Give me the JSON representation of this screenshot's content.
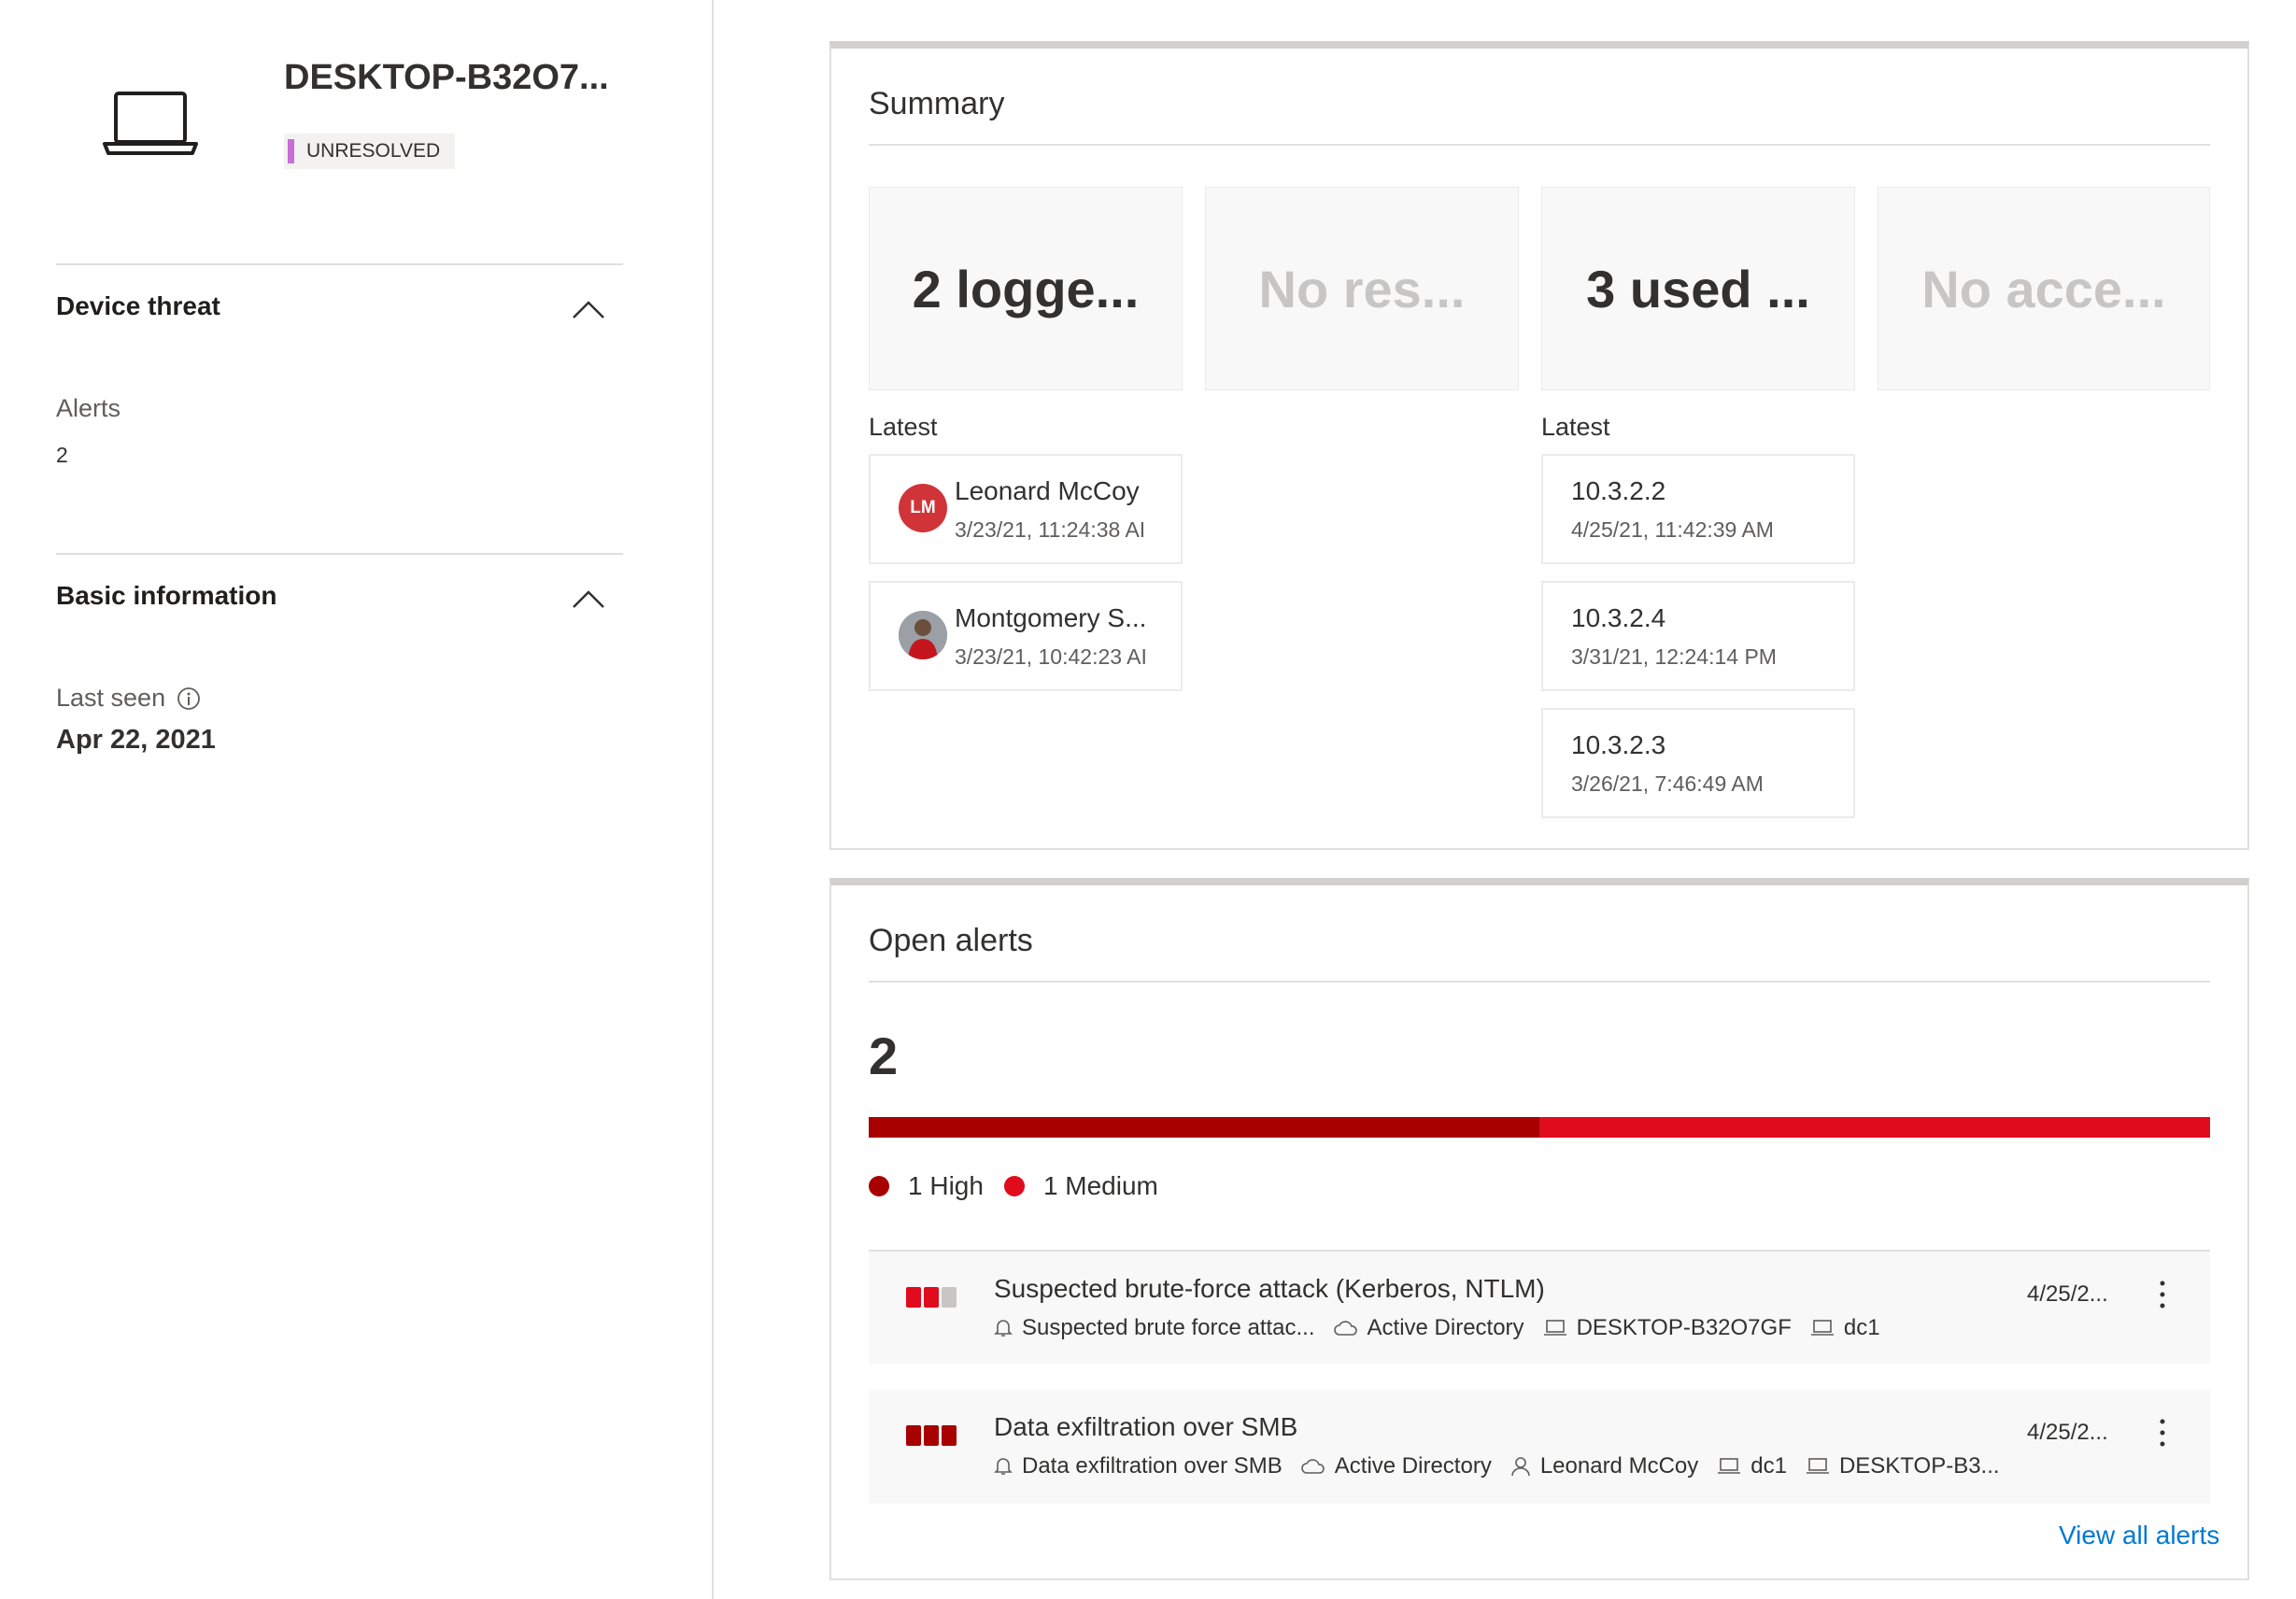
{
  "device": {
    "name": "DESKTOP-B32O7...",
    "status": "UNRESOLVED",
    "icon": "laptop-icon"
  },
  "device_threat": {
    "title": "Device threat",
    "alerts_label": "Alerts",
    "alerts_value": "2"
  },
  "basic_info": {
    "title": "Basic information",
    "last_seen_label": "Last seen",
    "last_seen_value": "Apr 22, 2021"
  },
  "summary": {
    "title": "Summary",
    "tiles": [
      {
        "text": "2 logge...",
        "style": "dark"
      },
      {
        "text": "No res...",
        "style": "muted"
      },
      {
        "text": "3 used ...",
        "style": "dark"
      },
      {
        "text": "No acce...",
        "style": "muted"
      }
    ],
    "latest_label": "Latest",
    "users": [
      {
        "name": "Leonard McCoy",
        "time": "3/23/21, 11:24:38 AI",
        "initials": "LM"
      },
      {
        "name": "Montgomery S...",
        "time": "3/23/21, 10:42:23 AI"
      }
    ],
    "ips": [
      {
        "ip": "10.3.2.2",
        "time": "4/25/21, 11:42:39 AM"
      },
      {
        "ip": "10.3.2.4",
        "time": "3/31/21, 12:24:14 PM"
      },
      {
        "ip": "10.3.2.3",
        "time": "3/26/21, 7:46:49 AM"
      }
    ]
  },
  "open_alerts": {
    "title": "Open alerts",
    "count": "2",
    "high_fraction": 0.5,
    "legend": {
      "high": "1 High",
      "medium": "1 Medium"
    },
    "colors": {
      "high": "#a80000",
      "medium": "#e00b1c",
      "inactive": "#c8c6c4"
    },
    "alerts": [
      {
        "title": "Suspected brute-force attack (Kerberos, NTLM)",
        "date": "4/25/2...",
        "severity": "medium",
        "meta": {
          "type": "Suspected brute force attac...",
          "source": "Active Directory",
          "device1": "DESKTOP-B32O7GF",
          "device2": "dc1"
        }
      },
      {
        "title": "Data exfiltration over SMB",
        "date": "4/25/2...",
        "severity": "high",
        "meta": {
          "type": "Data exfiltration over SMB",
          "source": "Active Directory",
          "user": "Leonard McCoy",
          "device1": "dc1",
          "device2": "DESKTOP-B3..."
        }
      }
    ],
    "view_all": "View all alerts"
  }
}
